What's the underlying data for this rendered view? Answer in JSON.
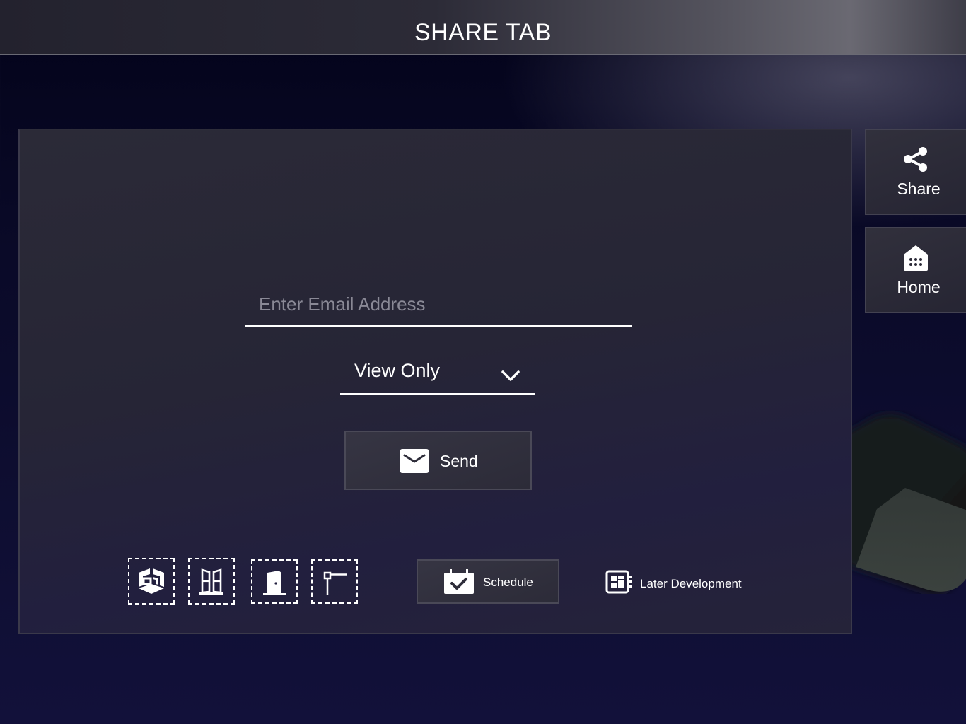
{
  "header": {
    "title": "SHARE TAB"
  },
  "sidebar": {
    "items": [
      {
        "label": "Share",
        "icon": "share-icon"
      },
      {
        "label": "Home",
        "icon": "home-icon"
      }
    ]
  },
  "share_form": {
    "email": {
      "value": "",
      "placeholder": "Enter Email Address"
    },
    "permission": {
      "selected": "View Only",
      "icon": "chevron-down-icon"
    },
    "send": {
      "label": "Send",
      "icon": "envelope-icon"
    }
  },
  "toolbar": {
    "tools": [
      {
        "name": "room-3d-icon"
      },
      {
        "name": "window-icon"
      },
      {
        "name": "door-icon"
      },
      {
        "name": "barrier-gate-icon"
      }
    ],
    "schedule": {
      "label": "Schedule",
      "icon": "calendar-check-icon"
    },
    "later_development": {
      "label": "Later Development",
      "icon": "floorplan-icon"
    }
  }
}
